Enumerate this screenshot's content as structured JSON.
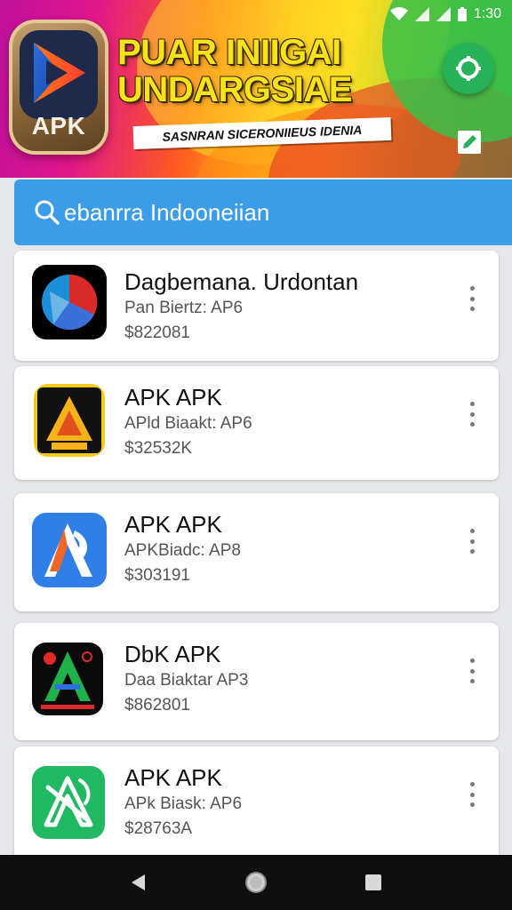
{
  "status_bar": {
    "time": "1:30"
  },
  "banner": {
    "logo_text": "APK",
    "title_line1": "PUAR INIIGAI",
    "title_line2": "UNDARGSIAE",
    "subtitle": "SASNRAN SICERONIIEUS IDENIA"
  },
  "search": {
    "value": "ebanrra Indooneiian"
  },
  "apps": [
    {
      "name": "Dagbemana. Urdontan",
      "desc": "Pan Biertz: AP6",
      "size": "$822081",
      "icon": "circle-app-icon"
    },
    {
      "name": "APK APK",
      "desc": "APld Biaakt: AP6",
      "size": "$32532K",
      "icon": "triangle-app-icon"
    },
    {
      "name": "APK APK",
      "desc": "APKBiadc: AP8",
      "size": "$303191",
      "icon": "blue-a-app-icon"
    },
    {
      "name": "DbK APK",
      "desc": "Daa Biaktar AP3",
      "size": "$862801",
      "icon": "green-a-app-icon"
    },
    {
      "name": "APK APK",
      "desc": "APk Biask: AP6",
      "size": "$28763A",
      "icon": "green-x-app-icon"
    }
  ],
  "colors": {
    "search_bg": "#3b9ce7",
    "fab_green": "#27b25a",
    "title_yellow": "#f8e31b",
    "nav_bg": "#0e0e0e"
  }
}
